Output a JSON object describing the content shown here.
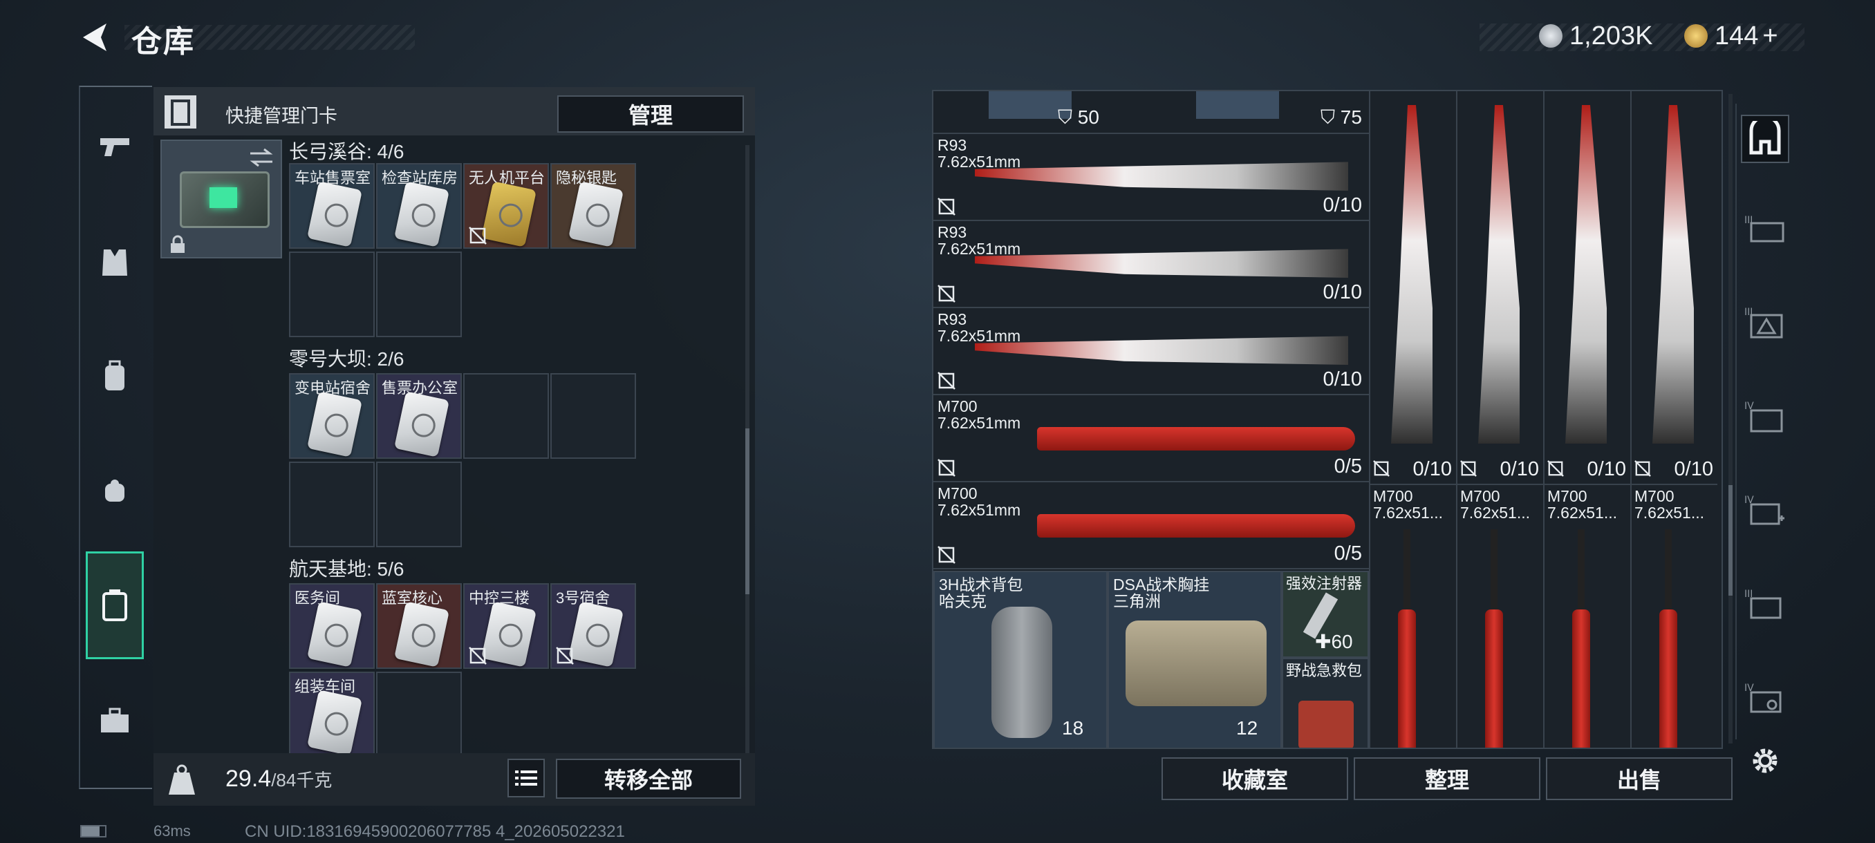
{
  "header": {
    "title": "仓库",
    "back_icon": "back-arrow-icon"
  },
  "currency": {
    "silver": "1,203K",
    "gold": "144",
    "gold_add": "+",
    "silver_color": "#c9ced4",
    "gold_color": "#e0b64a"
  },
  "left_panel": {
    "header_label": "快捷管理门卡",
    "manage_button": "管理",
    "groups": [
      {
        "title": "长弓溪谷: 4/6",
        "slots": [
          "车站售票室",
          "检查站库房",
          "无人机平台",
          "隐秘银匙"
        ]
      },
      {
        "title": "零号大坝: 2/6",
        "slots": [
          "变电站宿舍",
          "售票办公室"
        ]
      },
      {
        "title": "航天基地: 5/6",
        "slots": [
          "医务间",
          "蓝室核心",
          "中控三楼",
          "3号宿舍",
          "组装车间"
        ]
      }
    ],
    "weight": "29.4",
    "weight_max": "/84千克",
    "transfer_all_button": "转移全部"
  },
  "inventory": {
    "top_row": {
      "armor_a": "50",
      "armor_b": "75"
    },
    "weapons": [
      {
        "name": "R93",
        "caliber": "7.62x51mm",
        "ammo": "0/10"
      },
      {
        "name": "R93",
        "caliber": "7.62x51mm",
        "ammo": "0/10"
      },
      {
        "name": "R93",
        "caliber": "7.62x51mm",
        "ammo": "0/10"
      },
      {
        "name": "M700",
        "caliber": "7.62x51mm",
        "ammo": "0/5"
      },
      {
        "name": "M700",
        "caliber": "7.62x51mm",
        "ammo": "0/5"
      }
    ],
    "vertical_r93_ammo": [
      "0/10",
      "0/10",
      "0/10",
      "0/10"
    ],
    "vertical_m700": [
      {
        "name": "M700",
        "caliber": "7.62x51..."
      },
      {
        "name": "M700",
        "caliber": "7.62x51..."
      },
      {
        "name": "M700",
        "caliber": "7.62x51..."
      },
      {
        "name": "M700",
        "caliber": "7.62x51..."
      }
    ],
    "backpack": {
      "name": "3H战术背包",
      "sub": "哈夫克",
      "count": "18"
    },
    "vest": {
      "name": "DSA战术胸挂",
      "sub": "三角洲",
      "count": "12"
    },
    "injector": {
      "name": "强效注射器",
      "count": "60"
    },
    "medkit": {
      "name": "野战急救包"
    }
  },
  "bottom_buttons": {
    "collection": "收藏室",
    "organize": "整理",
    "sell": "出售"
  },
  "status": {
    "ping": "63ms",
    "uid": "CN UID:18316945900206077785 4_202605022321"
  }
}
